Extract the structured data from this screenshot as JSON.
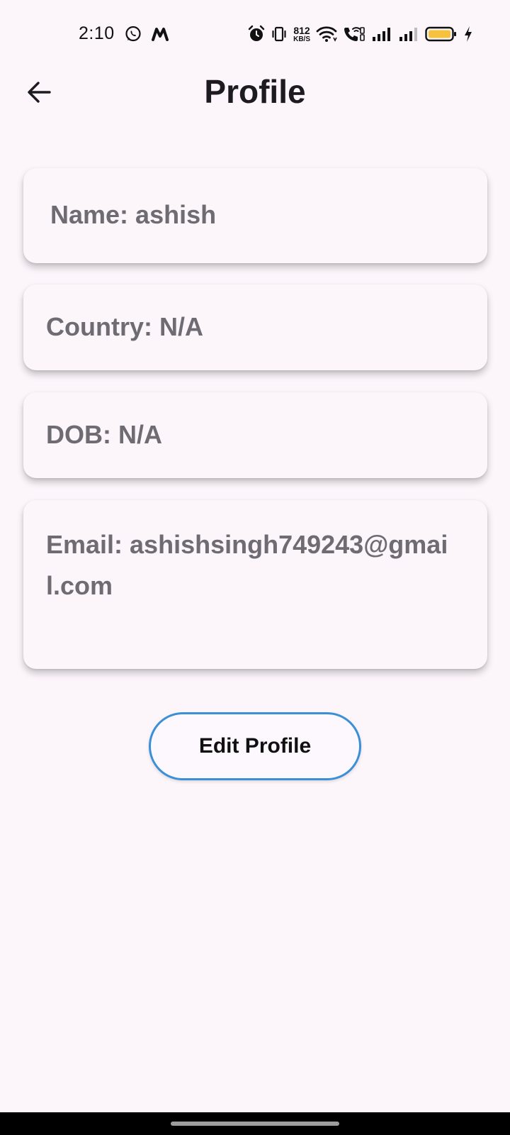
{
  "status_bar": {
    "time": "2:10",
    "net_speed_value": "812",
    "net_speed_unit": "KB/S",
    "battery_color": "#F6C23E",
    "icons": [
      "whatsapp-icon",
      "m-app-icon",
      "alarm-icon",
      "vibrate-icon",
      "wifi-icon",
      "wifi-call-icon",
      "signal-icon",
      "battery-icon",
      "charging-icon"
    ]
  },
  "app_bar": {
    "back_icon": "arrow-left-icon",
    "title": "Profile"
  },
  "profile": {
    "name": "Name: ashish",
    "country": "Country: N/A",
    "dob": "DOB: N/A",
    "email": "Email: ashishsingh749243@gmail.com"
  },
  "actions": {
    "edit_profile_label": "Edit Profile",
    "accent_color": "#3A8FD6"
  },
  "colors": {
    "background": "#FCF6FB",
    "card_text": "#6F6B72",
    "title": "#1D1B1F"
  }
}
